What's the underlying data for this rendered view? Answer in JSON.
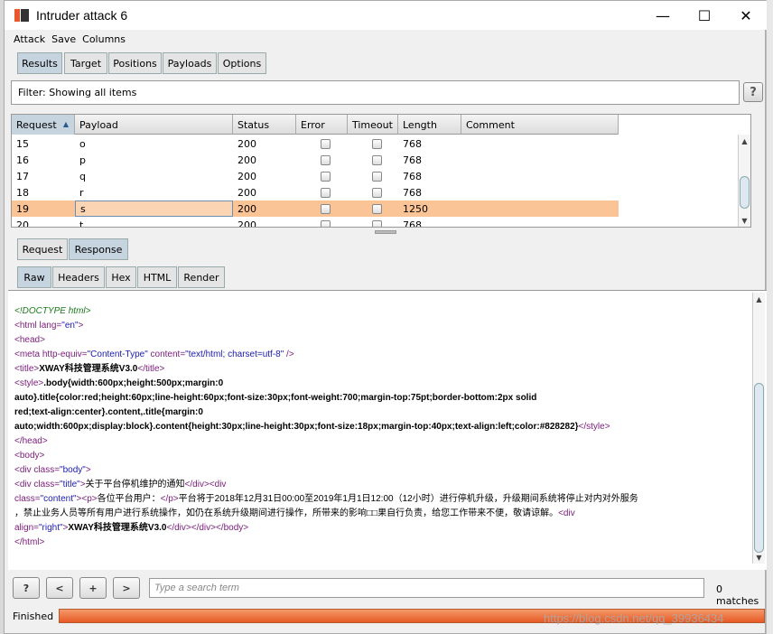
{
  "window": {
    "title": "Intruder attack 6",
    "controls": {
      "minimize": "—",
      "maximize": "☐",
      "close": "✕"
    }
  },
  "menu": [
    "Attack",
    "Save",
    "Columns"
  ],
  "main_tabs": [
    {
      "label": "Results",
      "active": true
    },
    {
      "label": "Target",
      "active": false
    },
    {
      "label": "Positions",
      "active": false
    },
    {
      "label": "Payloads",
      "active": false
    },
    {
      "label": "Options",
      "active": false
    }
  ],
  "filter": {
    "text": "Filter:  Showing all items",
    "help": "?"
  },
  "table": {
    "columns": [
      "Request",
      "Payload",
      "Status",
      "Error",
      "Timeout",
      "Length",
      "Comment"
    ],
    "sort_arrow": "▲",
    "rows": [
      {
        "request": "15",
        "payload": "o",
        "status": "200",
        "length": "768",
        "selected": false
      },
      {
        "request": "16",
        "payload": "p",
        "status": "200",
        "length": "768",
        "selected": false
      },
      {
        "request": "17",
        "payload": "q",
        "status": "200",
        "length": "768",
        "selected": false
      },
      {
        "request": "18",
        "payload": "r",
        "status": "200",
        "length": "768",
        "selected": false
      },
      {
        "request": "19",
        "payload": "s",
        "status": "200",
        "length": "1250",
        "selected": true
      },
      {
        "request": "20",
        "payload": "t",
        "status": "200",
        "length": "768",
        "selected": false
      }
    ],
    "selected_color": "#fbc497"
  },
  "req_resp_tabs": [
    {
      "label": "Request",
      "active": false
    },
    {
      "label": "Response",
      "active": true
    }
  ],
  "view_tabs": [
    {
      "label": "Raw",
      "active": true
    },
    {
      "label": "Headers",
      "active": false
    },
    {
      "label": "Hex",
      "active": false
    },
    {
      "label": "HTML",
      "active": false
    },
    {
      "label": "Render",
      "active": false
    }
  ],
  "response": {
    "doctype": "<!DOCTYPE html>",
    "html_open_tag": "<html ",
    "lang_attr": "lang=",
    "lang_val": "\"en\"",
    "gt": ">",
    "head_open": "<head>",
    "meta_open": "<meta ",
    "meta_equiv_attr": "<meta http-equiv=",
    "meta_equiv_val": "\"Content-Type\"",
    "meta_content_attr": " content=",
    "meta_content_val": "\"text/html; charset=utf-8\"",
    "meta_close": " />",
    "title_open": "<title>",
    "title_text": "XWAY科技管理系统V3.0",
    "title_close": "</title>",
    "style_open": "<style>",
    "css_line1": ".body{width:600px;height:500px;margin:0",
    "css_line2": "auto}.title{color:red;height:60px;line-height:60px;font-size:30px;font-weight:700;margin-top:75pt;border-bottom:2px solid",
    "css_line3": "red;text-align:center}.content,.title{margin:0",
    "css_line4": "auto;width:600px;display:block}.content{height:30px;line-height:30px;font-size:18px;margin-top:40px;text-align:left;color:#828282}",
    "style_close": "</style>",
    "head_close": "</head>",
    "body_open": "<body>",
    "div_open": "<div ",
    "class_attr": "class=",
    "body_class_val": "\"body\"",
    "title_class_val": "\"title\"",
    "title_div_text": "关于平台停机维护的通知",
    "div_close": "</div>",
    "div_tag": "<div",
    "content_class_val": "\"content\"",
    "p_open": "<p>",
    "greeting": "各位平台用户：",
    "p_close": "</p>",
    "notice_line1": "平台将于2018年12月31日00:00至2019年1月1日12:00（12小时）进行停机升级，升级期间系统将停止对内对外服务",
    "notice_line2": "，禁止业务人员等所有用户进行系统操作，如仍在系统升级期间进行操作，所带来的影响□□果自行负责，给您工作带来不便，敬请谅解。",
    "align_attr": "align=",
    "align_val": "\"right\"",
    "footer_text": "XWAY科技管理系统V3.0",
    "tail_close": "</div></div></body>",
    "html_close": "</html>"
  },
  "bottom": {
    "help": "?",
    "prev": "<",
    "add": "+",
    "next": ">",
    "search_placeholder": "Type a search term",
    "matches": "0 matches"
  },
  "status": {
    "text": "Finished",
    "progress_fraction": 1.0,
    "watermark": "https://blog.csdn.net/qq_39936434"
  }
}
